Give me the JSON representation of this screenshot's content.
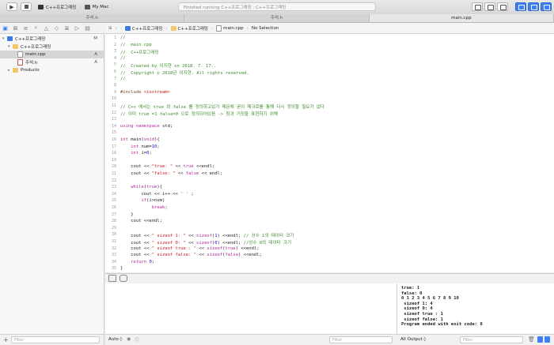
{
  "toolbar": {
    "scheme_target": "C++프로그래밍",
    "scheme_device": "My Mac",
    "activity": "Finished running C++프로그래밍 : C++프로그래밍"
  },
  "tabs": [
    "주석.h",
    "주석.h",
    "main.cpp"
  ],
  "navigator": {
    "items": [
      {
        "label": "C++프로그래밍",
        "badge": "M",
        "kind": "proj"
      },
      {
        "label": "C++프로그래밍",
        "badge": "",
        "kind": "folder"
      },
      {
        "label": "main.cpp",
        "badge": "A",
        "kind": "cpp"
      },
      {
        "label": "주석.h",
        "badge": "A",
        "kind": "h"
      },
      {
        "label": "Products",
        "badge": "",
        "kind": "folder"
      }
    ],
    "filter_placeholder": "Filter"
  },
  "jumpbar": {
    "crumbs": [
      "C++프로그래밍",
      "C++프로그래밍",
      "main.cpp",
      "No Selection"
    ]
  },
  "editor": {
    "lines": [
      "//",
      "//  main.cpp",
      "//  C++프로그래밍",
      "//",
      "//  Created by 이지현 on 2018. 7. 17..",
      "//  Copyright © 2018년 이지현. All rights reserved.",
      "//",
      "",
      "#include <iostream>",
      "",
      "// C++ 에서는 true 와 false 를 정의하고있기 때문에 굳이 매크로를 통해 다시 정의할 필요가 없다",
      "// 이미 true =1 false=0 으로 정의되어있음 -> 참과 거짓을 표현하기 위해",
      "",
      "using namespace std;",
      "",
      "int main(void){",
      "    int num=10;",
      "    int i=0;",
      "",
      "    cout << \"true: \" << true <<endl;",
      "    cout << \"false: \" << false << endl;",
      "",
      "    while(true){",
      "        cout << i++ << ' ' ;",
      "        if(i>num)",
      "            break;",
      "    }",
      "    cout <<endl;",
      "",
      "    cout << \" sizeof 1: \" << sizeof(1) <<endl; // 상수 1의 데이터 크기",
      "    cout << \" sizeof 0: \" << sizeof(0) <<endl; //상수 0의 데이터 크기",
      "    cout << \" sizeof true : \" << sizeof(true) <<endl;",
      "    cout << \" sizeof false: \" << sizeof(false) <<endl;",
      "    return 0;",
      "}",
      ""
    ],
    "current_line": 36
  },
  "console": {
    "lines": [
      "true: 1",
      "false: 0",
      "0 1 2 3 4 5 6 7 8 9 10",
      " sizeof 1: 4",
      " sizeof 0: 4",
      " sizeof true : 1",
      " sizeof false: 1",
      "Program ended with exit code: 0"
    ]
  },
  "bottombar": {
    "auto_label": "Auto ◊",
    "filter_placeholder": "Filter",
    "output_label": "All Output ◊"
  },
  "colors": {
    "accent": "#2f7cf6",
    "keyword": "#b0249c",
    "string": "#c41a16",
    "comment": "#3b8a2a"
  }
}
